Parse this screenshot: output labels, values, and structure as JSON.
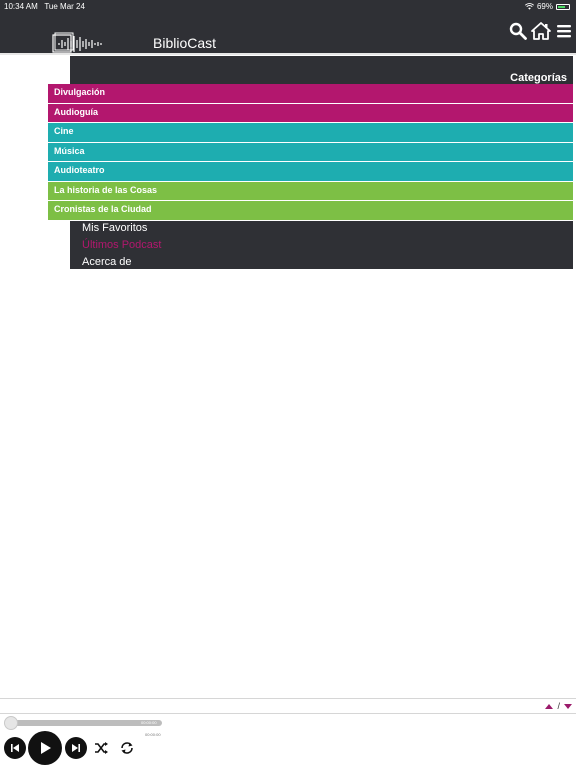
{
  "status_bar": {
    "time": "10:34 AM",
    "date": "Tue Mar 24",
    "battery": "69%"
  },
  "header": {
    "title": "BiblioCast",
    "icons": [
      "search-icon",
      "home-icon",
      "menu-icon"
    ]
  },
  "menu": {
    "heading": "Categorías",
    "categories": [
      {
        "label": "Divulgación",
        "color": "#b3176e"
      },
      {
        "label": "Audioguía",
        "color": "#b3176e"
      },
      {
        "label": "Cine",
        "color": "#1eadb0"
      },
      {
        "label": "Música",
        "color": "#1eadb0"
      },
      {
        "label": "Audioteatro",
        "color": "#1eadb0"
      },
      {
        "label": "La historia de las Cosas",
        "color": "#7dbf45"
      },
      {
        "label": "Cronistas de la Ciudad",
        "color": "#7dbf45"
      }
    ],
    "links": [
      {
        "label": "Mis Favoritos",
        "color": "#ffffff"
      },
      {
        "label": "Últimos Podcast",
        "color": "#b3176e"
      },
      {
        "label": "Acerca de",
        "color": "#ffffff"
      }
    ]
  },
  "player": {
    "nav_separator": "/",
    "elapsed": "00:00:00",
    "duration": "00:00:00",
    "progress": 0,
    "controls": [
      "previous-icon",
      "play-icon",
      "next-icon",
      "shuffle-icon",
      "repeat-icon"
    ]
  },
  "colors": {
    "header_bg": "#2f3035",
    "accent": "#9b1b6b"
  }
}
